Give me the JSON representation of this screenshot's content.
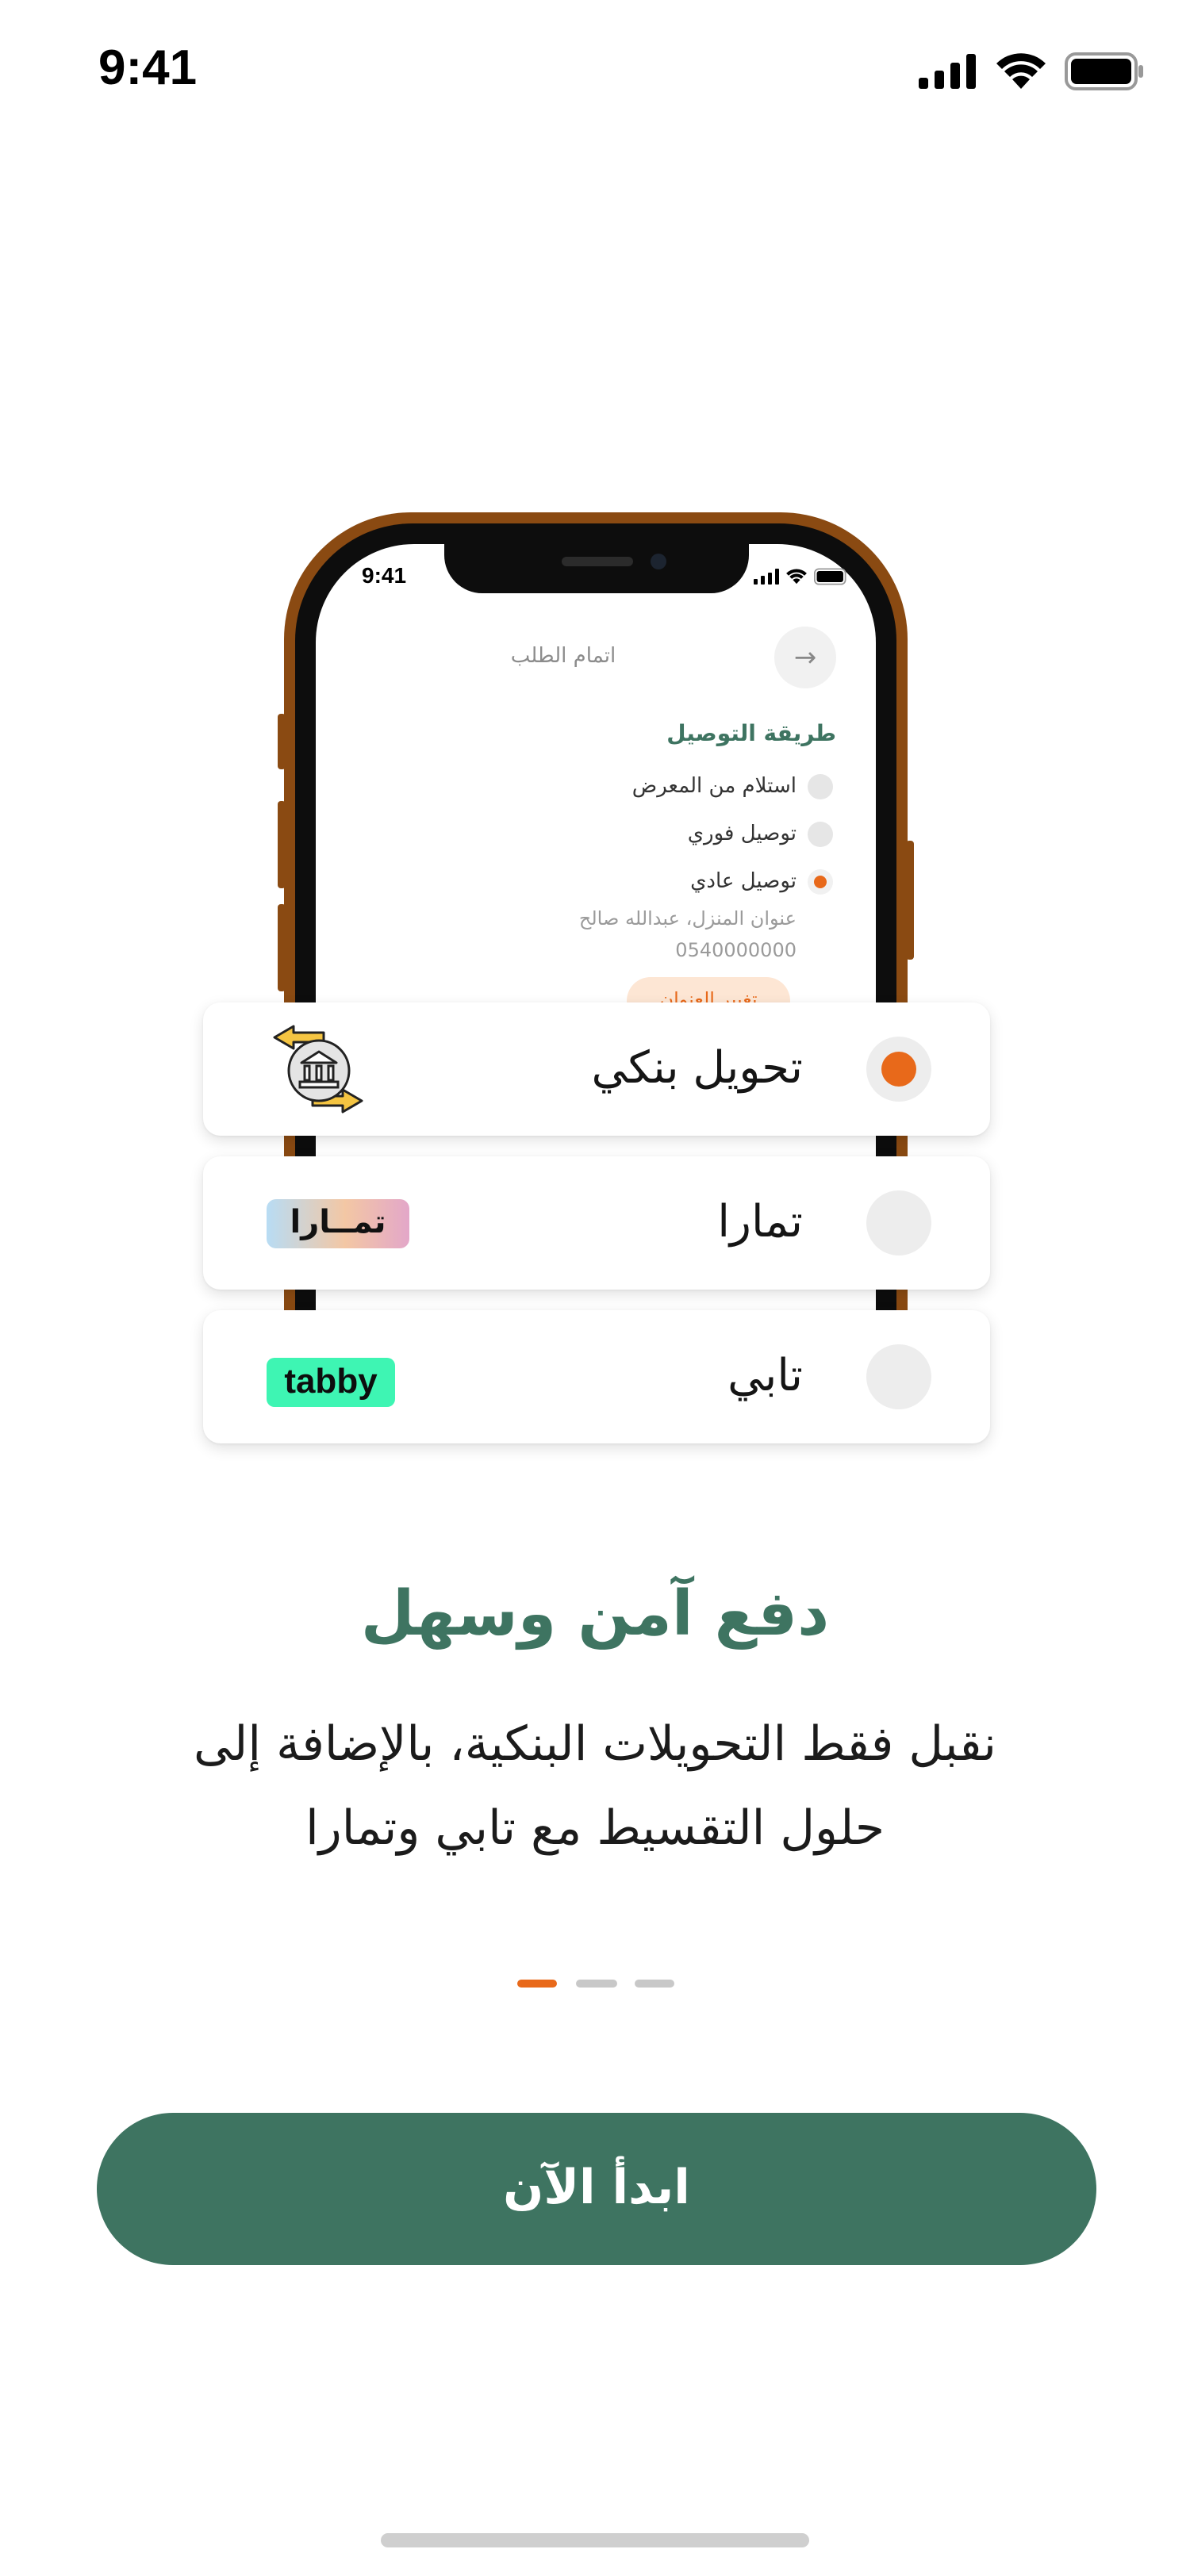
{
  "status_bar": {
    "time": "9:41"
  },
  "mockup": {
    "time": "9:41",
    "title": "اتمام الطلب",
    "section_title": "طريقة التوصيل",
    "options": [
      "استلام من المعرض",
      "توصيل فوري",
      "توصيل عادي"
    ],
    "address": "عنوان المنزل، عبدالله صالح",
    "phone": "0540000000",
    "change_address": "تغيير العنوان"
  },
  "payment_methods": [
    {
      "label": "تحويل بنكي",
      "selected": true,
      "icon": "bank-transfer-icon"
    },
    {
      "label": "تمارا",
      "selected": false,
      "logo_text": "تمــارا"
    },
    {
      "label": "تابي",
      "selected": false,
      "logo_text": "tabby"
    }
  ],
  "headline": "دفع آمن وسهل",
  "body_line1": "نقبل فقط التحويلات البنكية، بالإضافة إلى",
  "body_line2": "حلول التقسيط مع تابي وتمارا",
  "pager": {
    "total": 3,
    "active": 1
  },
  "cta_label": "ابدأ الآن",
  "colors": {
    "primary": "#3e7461",
    "accent": "#e8691a",
    "tabby": "#3ef5b3"
  }
}
